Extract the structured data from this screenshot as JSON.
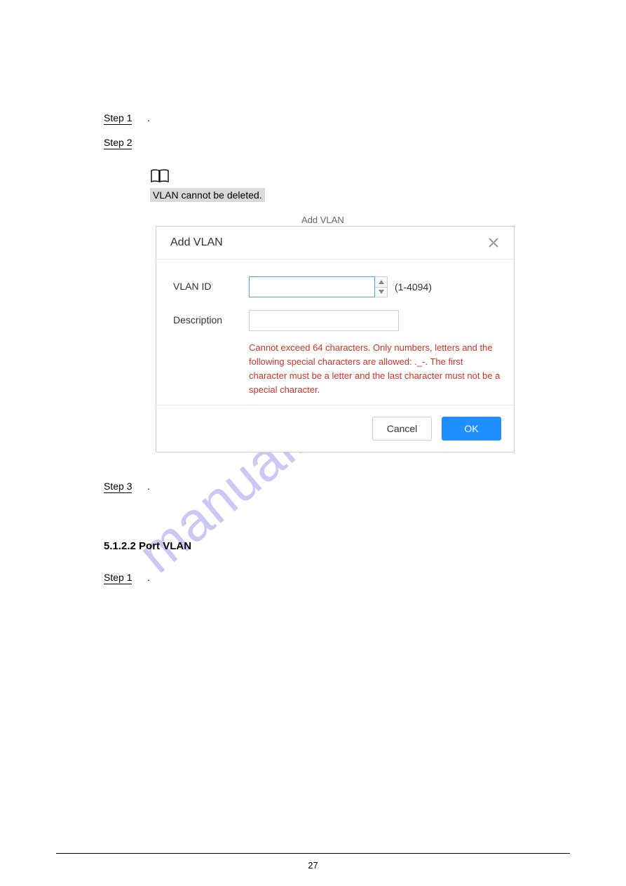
{
  "steps": {
    "step1": {
      "label": "Step 1",
      "text": "."
    },
    "step2": {
      "label": "Step 2",
      "text": ""
    },
    "step3": {
      "label": "Step 3",
      "text": "."
    },
    "step1_lower": {
      "label": "Step 1",
      "text": "."
    }
  },
  "note": {
    "highlight_text": "VLAN cannot be deleted."
  },
  "figure_caption": "Add VLAN",
  "dialog": {
    "title": "Add VLAN",
    "vlan_id_label": "VLAN ID",
    "vlan_id_value": "",
    "vlan_id_range": "(1-4094)",
    "description_label": "Description",
    "description_value": "",
    "validation_text": "Cannot exceed 64 characters. Only numbers, letters and the following special characters are allowed: ._-. The first character must be a letter and the last character must not be a special character.",
    "cancel_label": "Cancel",
    "ok_label": "OK"
  },
  "sections": {
    "port_vlan": "5.1.2.2 Port VLAN"
  },
  "watermark": "manualshive.com",
  "page_number": "27"
}
